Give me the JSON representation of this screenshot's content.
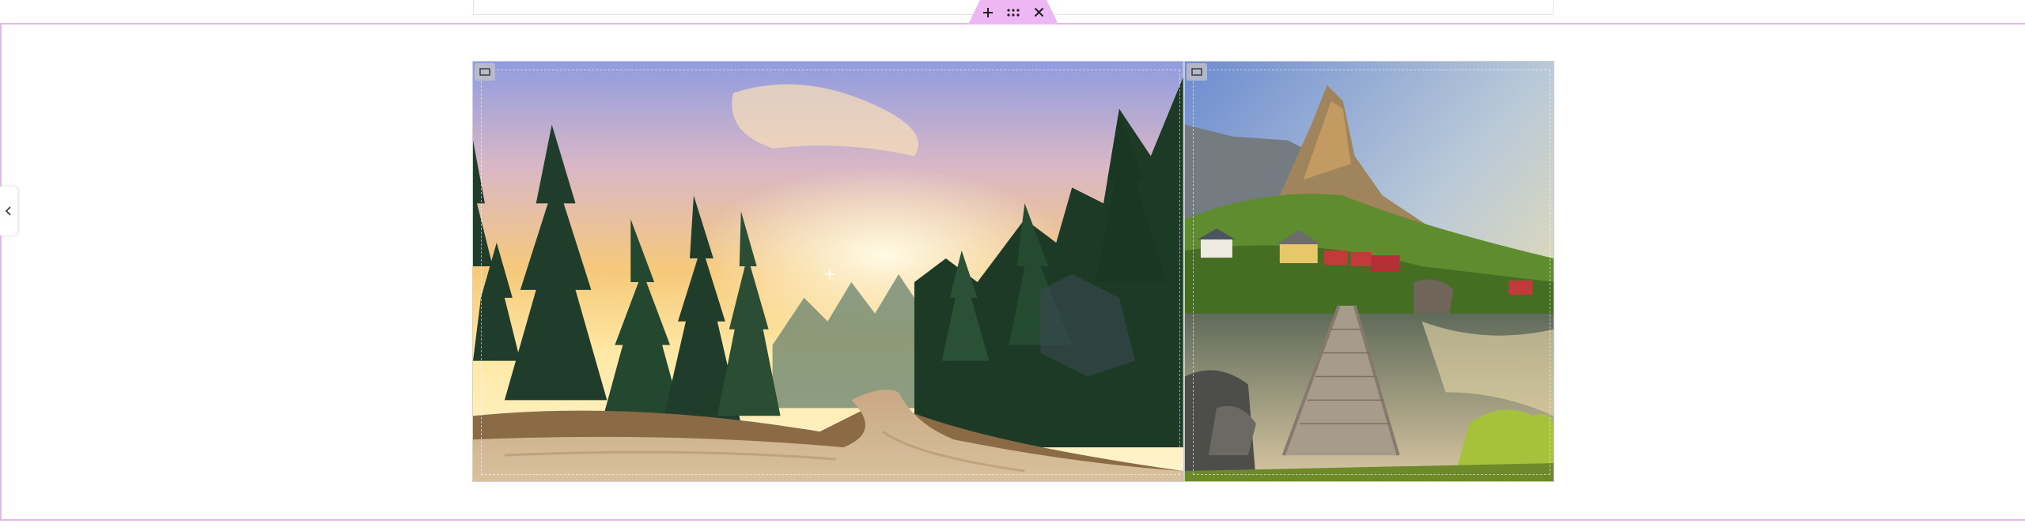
{
  "editor": {
    "accent_color": "#ecb7f3",
    "section_toolbar": {
      "icons": [
        "plus-icon",
        "drag-grid-icon",
        "close-icon"
      ]
    },
    "side_panel_toggle_icon": "chevron-left-icon"
  },
  "gallery": {
    "images": [
      {
        "subject": "forest-road-sunset",
        "handle_icon": "image-handle-icon"
      },
      {
        "subject": "fjord-boardwalk-mountain",
        "handle_icon": "image-handle-icon"
      }
    ]
  }
}
